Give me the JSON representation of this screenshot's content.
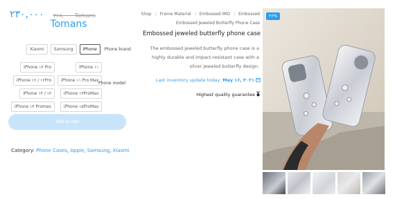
{
  "price": {
    "new": "۲۳۰,۰۰۰",
    "old": "۳۶۸,۰۰۰",
    "old_currency": "Tomans",
    "currency": "Tomans"
  },
  "options": {
    "brand_label": "Phone brand",
    "brands": [
      "Xiaomi",
      "Samsung",
      "iPhone"
    ],
    "selected_brand": "iPhone",
    "model_label": "Phone model",
    "models": [
      "iPhone ۱۳ Pro",
      "iPhone ۱۱",
      "iPhone ۱۱ Pro Max",
      "iPhone ۱۲ / ۱۲Pro",
      "iPhone ۱۳ProMax",
      "iPhone ۱۴ / ۱۳",
      "iPhone ۱۵ProMax",
      "iPhone ۱۴ Promax"
    ]
  },
  "cart": {
    "label": "Add to cart"
  },
  "category": {
    "label": "Category:",
    "items": [
      "Phone Cases",
      "Apple",
      "Samsung",
      "Xiaomi"
    ]
  },
  "breadcrumb": [
    "Shop",
    "Frame Material",
    "Embossed IMD",
    "Embossed",
    "Embossed Jeweled Butterfly Phone Case"
  ],
  "product": {
    "title": "Embossed jeweled butterfly phone case",
    "description": "The embossed jeweled butterfly phone case is a highly durable and impact-resistant case with a silver jeweled butterfly design.",
    "inventory_prefix": "Last inventory update today,",
    "inventory_date": "May ۱۶, ۲۰۲۱",
    "quality": "Highest quality guarantee",
    "badge": "۳۶%"
  },
  "colors": {
    "accent": "#2a9df4",
    "button": "#c7e4fb"
  }
}
